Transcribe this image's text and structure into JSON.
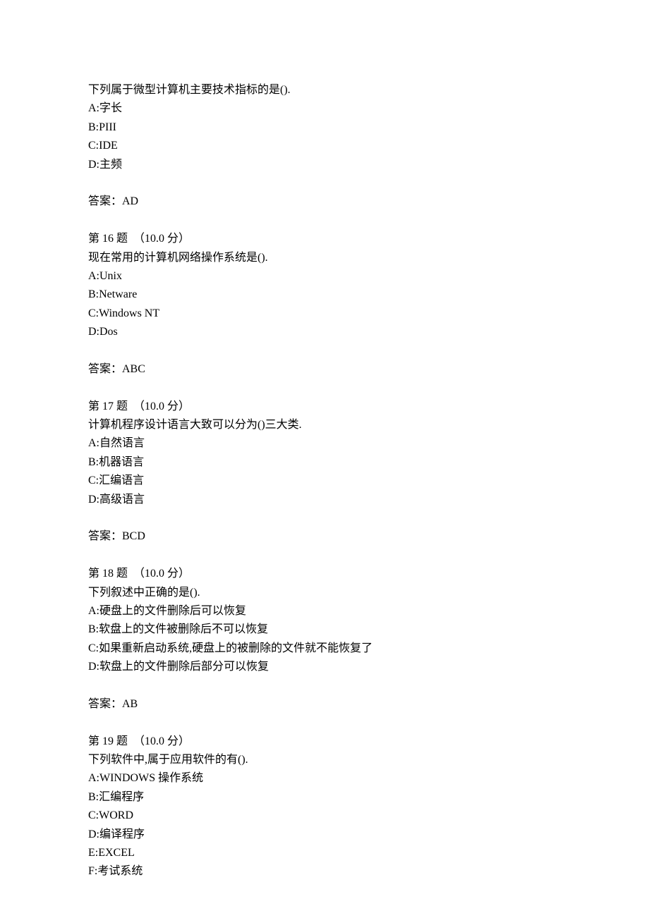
{
  "q15": {
    "stem": "下列属于微型计算机主要技术指标的是().",
    "options": {
      "a": "A:字长",
      "b": "B:PIII",
      "c": "C:IDE",
      "d": "D:主频"
    },
    "answer": "答案：AD"
  },
  "q16": {
    "header": "第 16 题  （10.0 分）",
    "stem": "现在常用的计算机网络操作系统是().",
    "options": {
      "a": "A:Unix",
      "b": "B:Netware",
      "c": "C:Windows NT",
      "d": "D:Dos"
    },
    "answer": "答案：ABC"
  },
  "q17": {
    "header": "第 17 题  （10.0 分）",
    "stem": "计算机程序设计语言大致可以分为()三大类.",
    "options": {
      "a": "A:自然语言",
      "b": "B:机器语言",
      "c": "C:汇编语言",
      "d": "D:高级语言"
    },
    "answer": "答案：BCD"
  },
  "q18": {
    "header": "第 18 题  （10.0 分）",
    "stem": "下列叙述中正确的是().",
    "options": {
      "a": "A:硬盘上的文件删除后可以恢复",
      "b": "B:软盘上的文件被删除后不可以恢复",
      "c": "C:如果重新启动系统,硬盘上的被删除的文件就不能恢复了",
      "d": "D:软盘上的文件删除后部分可以恢复"
    },
    "answer": "答案：AB"
  },
  "q19": {
    "header": "第 19 题  （10.0 分）",
    "stem": "下列软件中,属于应用软件的有().",
    "options": {
      "a": "A:WINDOWS 操作系统",
      "b": "B:汇编程序",
      "c": "C:WORD",
      "d": "D:编译程序",
      "e": "E:EXCEL",
      "f": "F:考试系统"
    }
  }
}
